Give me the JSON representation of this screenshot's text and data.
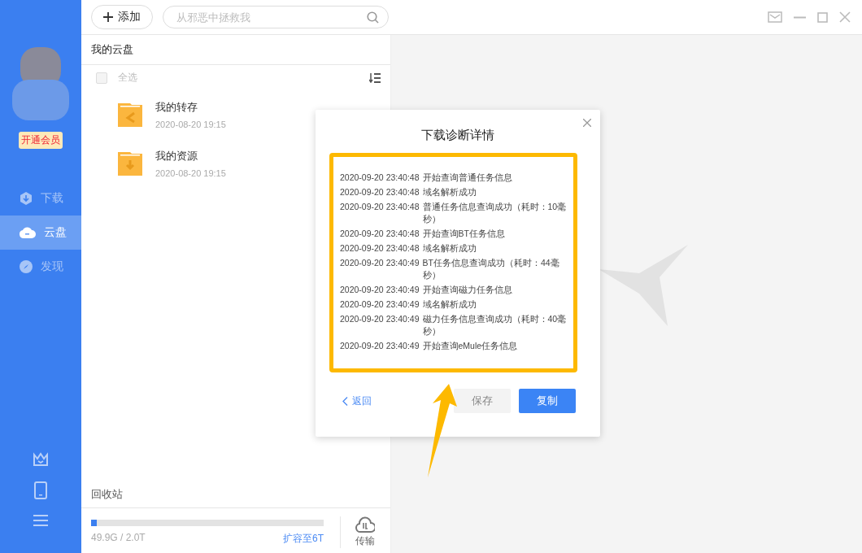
{
  "sidebar": {
    "vip_badge": "开通会员",
    "nav": [
      {
        "label": "下载",
        "kind": "download",
        "selected": false
      },
      {
        "label": "云盘",
        "kind": "cloud",
        "selected": true
      },
      {
        "label": "发现",
        "kind": "discover",
        "selected": false
      }
    ]
  },
  "toolbar": {
    "add_button": "添加",
    "search": {
      "placeholder": "从邪恶中拯救我"
    }
  },
  "panel": {
    "title": "我的云盘",
    "select_all": {
      "label": "全选",
      "checked": false
    },
    "folders": [
      {
        "name": "我的转存",
        "date": "2020-08-20 19:15",
        "kind": "transfer"
      },
      {
        "name": "我的资源",
        "date": "2020-08-20 19:15",
        "kind": "resource"
      }
    ],
    "recycle_bin": "回收站",
    "storage": {
      "level": 0.025,
      "usage": "49.9G / 2.0T",
      "expand_link": "扩容至6T"
    },
    "transfer": "传输"
  },
  "dialog": {
    "title": "下载诊断详情",
    "log": [
      {
        "time": "2020-09-20 23:40:48",
        "message": "开始查询普通任务信息"
      },
      {
        "time": "2020-09-20 23:40:48",
        "message": "域名解析成功"
      },
      {
        "time": "2020-09-20 23:40:48",
        "message": "普通任务信息查询成功（耗时：10毫秒）"
      },
      {
        "time": "2020-09-20 23:40:48",
        "message": "开始查询BT任务信息"
      },
      {
        "time": "2020-09-20 23:40:48",
        "message": "域名解析成功"
      },
      {
        "time": "2020-09-20 23:40:49",
        "message": "BT任务信息查询成功（耗时：44毫秒）"
      },
      {
        "time": "2020-09-20 23:40:49",
        "message": "开始查询磁力任务信息"
      },
      {
        "time": "2020-09-20 23:40:49",
        "message": "域名解析成功"
      },
      {
        "time": "2020-09-20 23:40:49",
        "message": "磁力任务信息查询成功（耗时：40毫秒）"
      },
      {
        "time": "2020-09-20 23:40:49",
        "message": "开始查询eMule任务信息"
      }
    ],
    "back_link": "返回",
    "buttons": [
      {
        "label": "保存",
        "kind": "secondary"
      },
      {
        "label": "复制",
        "kind": "primary"
      }
    ]
  }
}
